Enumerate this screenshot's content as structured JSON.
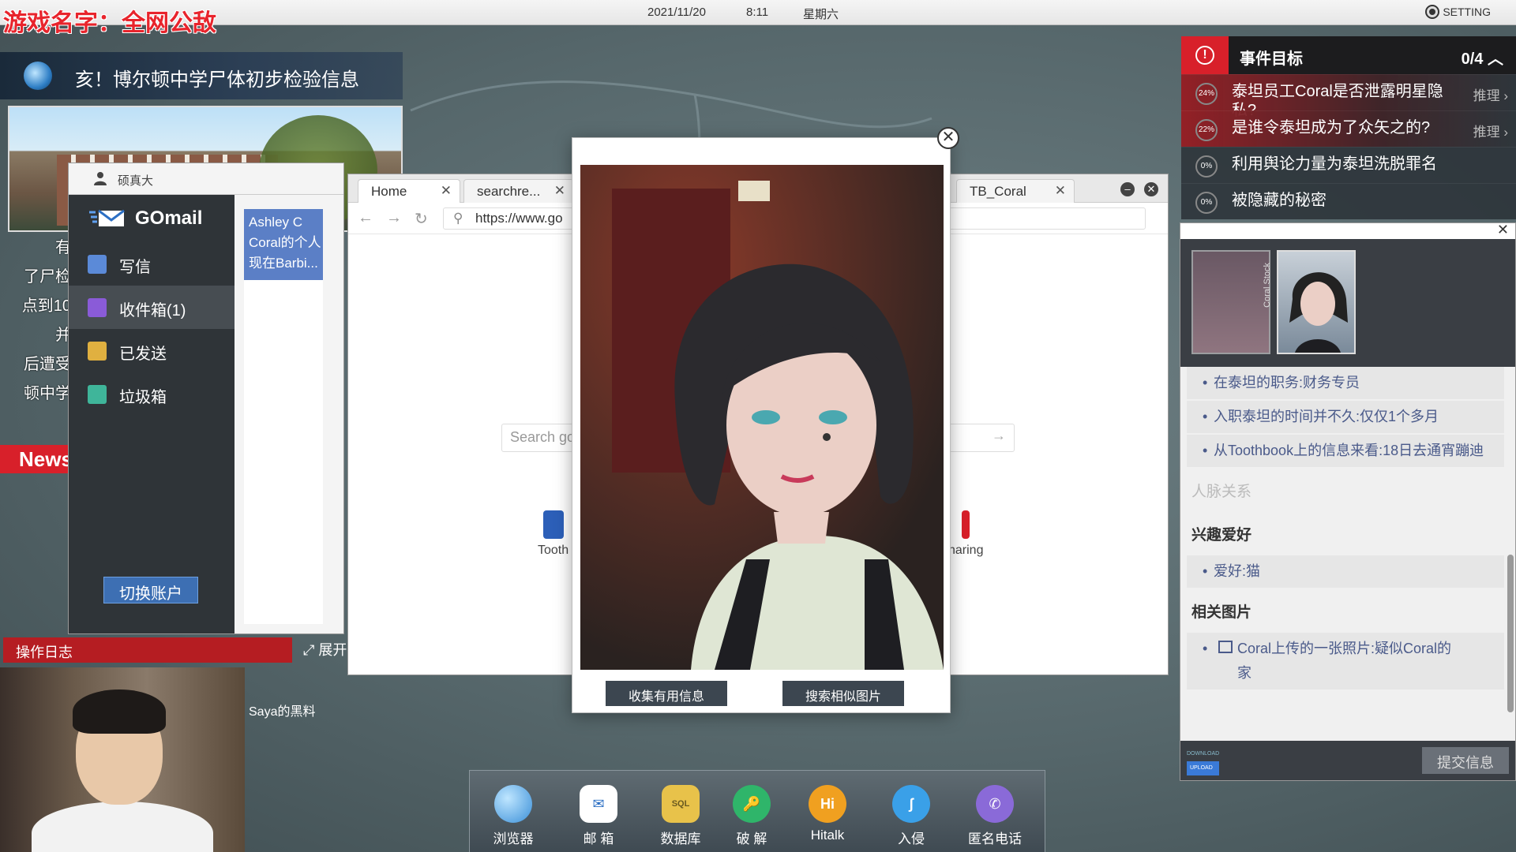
{
  "overlay": {
    "stream_title": "游戏名字：全网公敌"
  },
  "topbar": {
    "date": "2021/11/20",
    "time": "8:11",
    "weekday": "星期六",
    "setting_label": "SETTING"
  },
  "news": {
    "headline": "亥！博尔顿中学尸体初步检验信息",
    "side_lines": [
      "有",
      "了尸检",
      "点到10",
      "并",
      "后遭受",
      "顿中学"
    ],
    "tag": "News"
  },
  "mail": {
    "user": "硕真大",
    "brand": "GOmail",
    "nav": [
      {
        "label": "写信",
        "color": "#5b8ad8"
      },
      {
        "label": "收件箱(1)",
        "color": "#8a5bd8"
      },
      {
        "label": "已发送",
        "color": "#e0b040"
      },
      {
        "label": "垃圾箱",
        "color": "#3fb59a"
      }
    ],
    "switch_account": "切换账户",
    "preview": {
      "sender": "Ashley C",
      "line1": "Coral的个人",
      "line2": "现在Barbi..."
    }
  },
  "browser": {
    "tabs": [
      {
        "label": "Home"
      },
      {
        "label": "searchre..."
      },
      {
        "label": "TB_Coral"
      }
    ],
    "url": "https://www.go",
    "search_placeholder": "Search go",
    "quick_links": [
      {
        "label": "Tooth"
      },
      {
        "label": "haring"
      }
    ]
  },
  "viewer": {
    "buttons": {
      "collect": "收集有用信息",
      "search_similar": "搜索相似图片"
    }
  },
  "objectives": {
    "title": "事件目标",
    "count": "0/4",
    "items": [
      {
        "pct": "24%",
        "text": "泰坦员工Coral是否泄露明星隐私?",
        "action": "推理"
      },
      {
        "pct": "22%",
        "text": "是谁令泰坦成为了众矢之的?",
        "action": "推理"
      },
      {
        "pct": "0%",
        "text": "利用舆论力量为泰坦洗脱罪名",
        "action": ""
      },
      {
        "pct": "0%",
        "text": "被隐藏的秘密",
        "action": ""
      }
    ]
  },
  "profile": {
    "portrait_labels": [
      "Coral Stock"
    ],
    "facts": [
      "在泰坦的职务:财务专员",
      "入职泰坦的时间并不久:仅仅1个多月",
      "从Toothbook上的信息来看:18日去通宵蹦迪"
    ],
    "section_faded": "人脉关系",
    "section_hobby": "兴趣爱好",
    "hobby": "爱好:猫",
    "section_images": "相关图片",
    "image_fact": "Coral上传的一张照片:疑似Coral的家",
    "download_label": "DOWNLOAD",
    "upload_label": "UPLOAD",
    "submit": "提交信息"
  },
  "log": {
    "title": "操作日志",
    "expand": "展开",
    "saya": "Saya的黑料"
  },
  "dock": [
    {
      "label": "浏览器",
      "icon": "browser-icon",
      "color": "#3a8fd8"
    },
    {
      "label": "邮 箱",
      "icon": "mail-icon",
      "color": "#2c6fc4"
    },
    {
      "label": "数据库",
      "icon": "database-icon",
      "color": "#e8c24a"
    },
    {
      "label": "破 解",
      "icon": "crack-icon",
      "color": "#2fb56a"
    },
    {
      "label": "Hitalk",
      "icon": "hitalk-icon",
      "color": "#f0a020"
    },
    {
      "label": "入侵",
      "icon": "hook-icon",
      "color": "#3aa0e8"
    },
    {
      "label": "匿名电话",
      "icon": "phone-icon",
      "color": "#8a6ad8"
    }
  ]
}
